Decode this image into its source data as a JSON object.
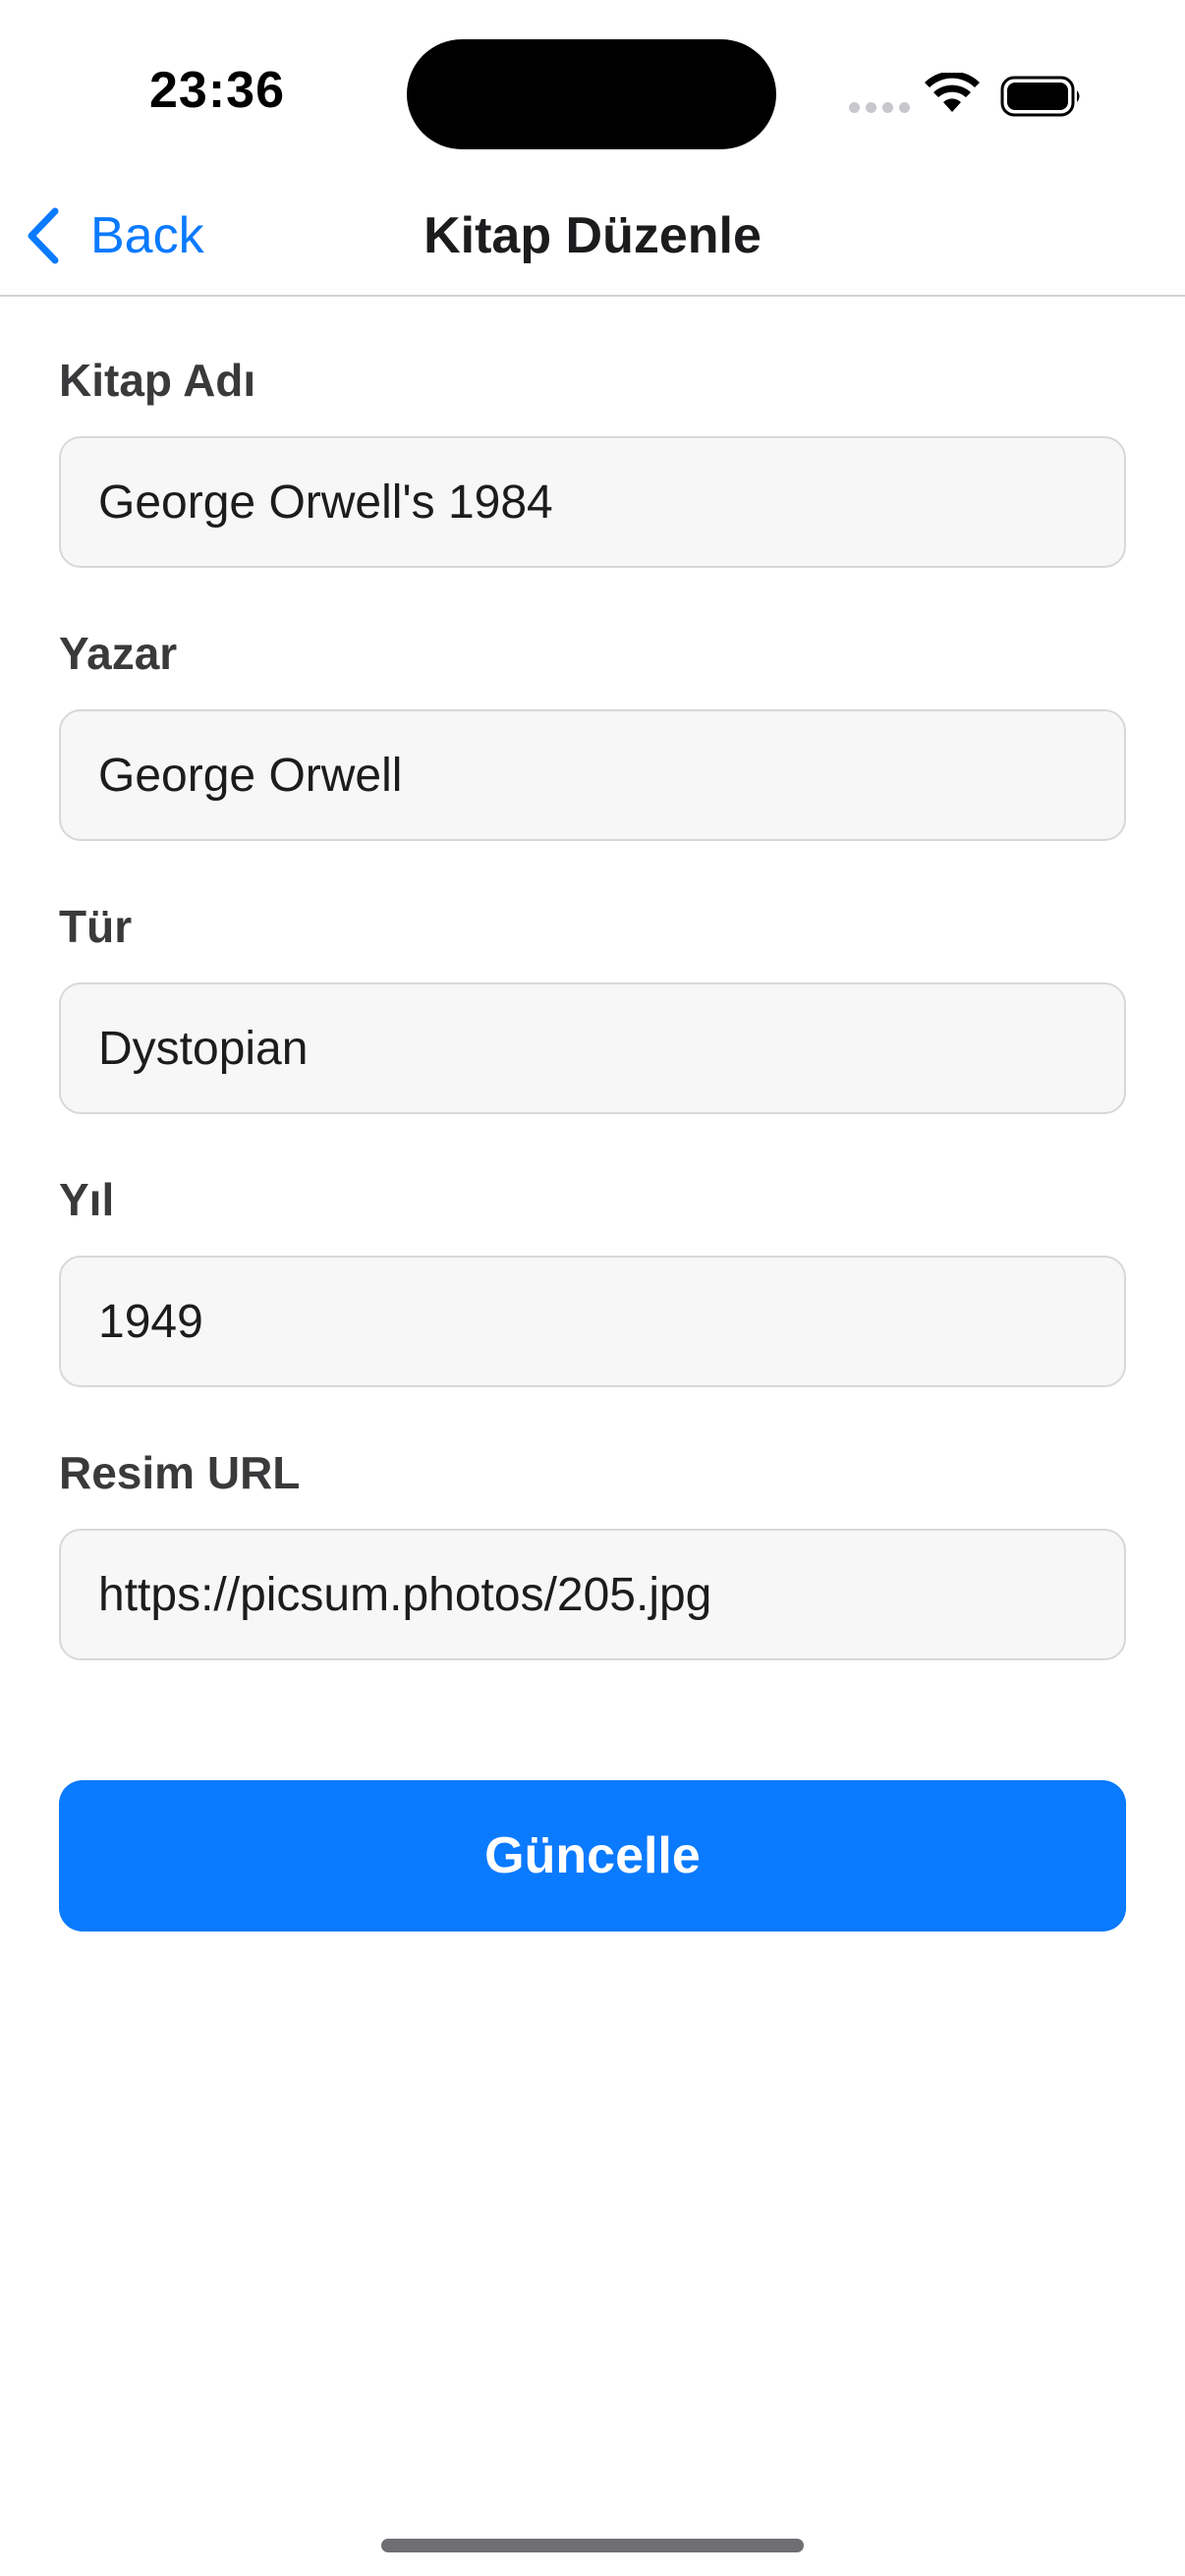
{
  "status_bar": {
    "time": "23:36"
  },
  "nav": {
    "back_label": "Back",
    "title": "Kitap Düzenle"
  },
  "form": {
    "fields": [
      {
        "label": "Kitap Adı",
        "value": "George Orwell's 1984"
      },
      {
        "label": "Yazar",
        "value": "George Orwell"
      },
      {
        "label": "Tür",
        "value": "Dystopian"
      },
      {
        "label": "Yıl",
        "value": "1949"
      },
      {
        "label": "Resim URL",
        "value": "https://picsum.photos/205.jpg"
      }
    ],
    "submit_label": "Güncelle"
  },
  "colors": {
    "accent": "#0a7aff",
    "input_background": "#f7f7f7",
    "input_border": "#d8d8dc"
  }
}
